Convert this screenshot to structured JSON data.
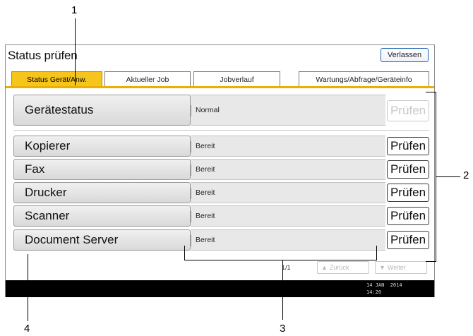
{
  "window": {
    "title": "Status prüfen",
    "exit_label": "Verlassen"
  },
  "tabs": [
    {
      "label": "Status Gerät/Anw.",
      "active": true
    },
    {
      "label": "Aktueller Job",
      "active": false
    },
    {
      "label": "Jobverlauf",
      "active": false
    },
    {
      "label": "Wartungs/Abfrage/Geräteinfo",
      "active": false
    }
  ],
  "device_status": {
    "name": "Gerätestatus",
    "status": "Normal",
    "check_label": "Prüfen"
  },
  "functions": [
    {
      "name": "Kopierer",
      "status": "Bereit",
      "check_label": "Prüfen"
    },
    {
      "name": "Fax",
      "status": "Bereit",
      "check_label": "Prüfen"
    },
    {
      "name": "Drucker",
      "status": "Bereit",
      "check_label": "Prüfen"
    },
    {
      "name": "Scanner",
      "status": "Bereit",
      "check_label": "Prüfen"
    },
    {
      "name": "Document Server",
      "status": "Bereit",
      "check_label": "Prüfen"
    }
  ],
  "pagination": {
    "page": "1/1",
    "back_label": "Zurück",
    "next_label": "Weiter"
  },
  "footer": {
    "date": "14 JAN  2014",
    "time": "14:20"
  },
  "callouts": {
    "c1": "1",
    "c2": "2",
    "c3": "3",
    "c4": "4"
  },
  "colors": {
    "active_tab": "#f6c51b",
    "tab_underline": "#e8b000",
    "exit_border": "#1f62b3",
    "footer": "#000000"
  },
  "icons": {
    "back": "triangle-up-icon",
    "next": "triangle-down-icon"
  }
}
